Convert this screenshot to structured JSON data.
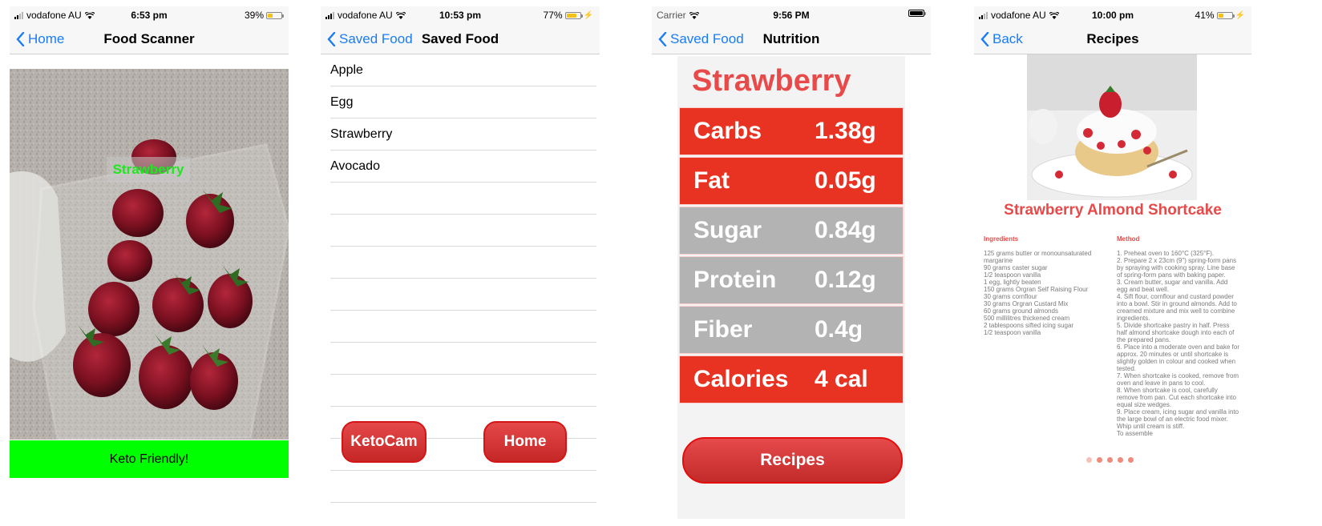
{
  "screens": [
    {
      "status": {
        "carrier": "vodafone AU",
        "time": "6:53 pm",
        "battery": "39%"
      },
      "nav": {
        "back_label": "Home",
        "title": "Food Scanner"
      },
      "detection_label": "Strawberry",
      "result_banner": "Keto Friendly!"
    },
    {
      "status": {
        "carrier": "vodafone AU",
        "time": "10:53 pm",
        "battery": "77%"
      },
      "nav": {
        "back_label": "Saved Food",
        "title": "Saved Food"
      },
      "saved_items": [
        "Apple",
        "Egg",
        "Strawberry",
        "Avocado"
      ],
      "buttons": {
        "ketocam": "KetoCam",
        "home": "Home"
      }
    },
    {
      "status": {
        "carrier": "Carrier",
        "time": "9:56 PM"
      },
      "nav": {
        "back_label": "Saved Food",
        "title": "Nutrition"
      },
      "food_name": "Strawberry",
      "nutrition": [
        {
          "label": "Carbs",
          "value": "1.38g",
          "color": "#e83323"
        },
        {
          "label": "Fat",
          "value": "0.05g",
          "color": "#e83323"
        },
        {
          "label": "Sugar",
          "value": "0.84g",
          "color": "#b3b3b3"
        },
        {
          "label": "Protein",
          "value": "0.12g",
          "color": "#b3b3b3"
        },
        {
          "label": "Fiber",
          "value": "0.4g",
          "color": "#b3b3b3"
        },
        {
          "label": "Calories",
          "value": "4 cal",
          "color": "#e83323"
        }
      ],
      "recipes_button": "Recipes"
    },
    {
      "status": {
        "carrier": "vodafone AU",
        "time": "10:00 pm",
        "battery": "41%"
      },
      "nav": {
        "back_label": "Back",
        "title": "Recipes"
      },
      "recipe_title": "Strawberry Almond Shortcake",
      "ingredients_heading": "Ingredients",
      "ingredients": "125 grams butter or monounsaturated\nmargarine\n90 grams caster sugar\n1/2 teaspoon vanilla\n1 egg, lightly beaten\n150 grams Orgran Self Raising Flour\n30 grams cornflour\n30 grams Orgran Custard Mix\n60 grams ground almonds\n500 millilitres thickened cream\n2 tablespoons sifted icing sugar\n1/2 teaspoon vanilla",
      "method_heading": "Method",
      "method": "1. Preheat oven to 160°C (325°F).\n2. Prepare 2 x 23cm (9\") spring-form pans\nby spraying with cooking spray. Line base\nof spring-form pans with baking paper.\n3. Cream butter, sugar and vanilla. Add\negg and beat well.\n4. Sift flour, cornflour and custard powder\ninto a bowl. Stir in ground almonds. Add to\ncreamed mixture and mix well to combine\ningredients.\n5. Divide shortcake pastry in half. Press\nhalf almond shortcake dough into each of\nthe prepared pans.\n6. Place into a moderate oven and bake for\napprox. 20 minutes or until shortcake is\nslightly golden in colour and cooked when\ntested.\n7. When shortcake is cooked, remove from\noven and leave in pans to cool.\n8. When shortcake is cool, carefully\nremove from pan. Cut each shortcake into\nequal size wedges.\n9. Place cream, icing sugar and vanilla into\nthe large bowl of an electric food mixer.\nWhip until cream is stiff.\nTo assemble",
      "page_count": 5
    }
  ],
  "colors": {
    "ios_blue": "#1a7cf5",
    "keto_green": "#00ff00",
    "accent_red": "#e84a4a"
  }
}
